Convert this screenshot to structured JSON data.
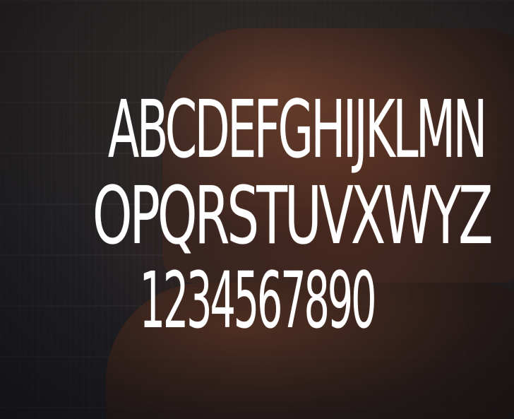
{
  "specimen": {
    "uppercase_row_1": "ABCDEFGHIJKLMN",
    "uppercase_row_2": "OPQRSTUVXWYZ",
    "digits_row": "1234567890"
  },
  "colors": {
    "text": "#ffffff",
    "background": "#1e1d22",
    "leather": "#3b2620"
  }
}
